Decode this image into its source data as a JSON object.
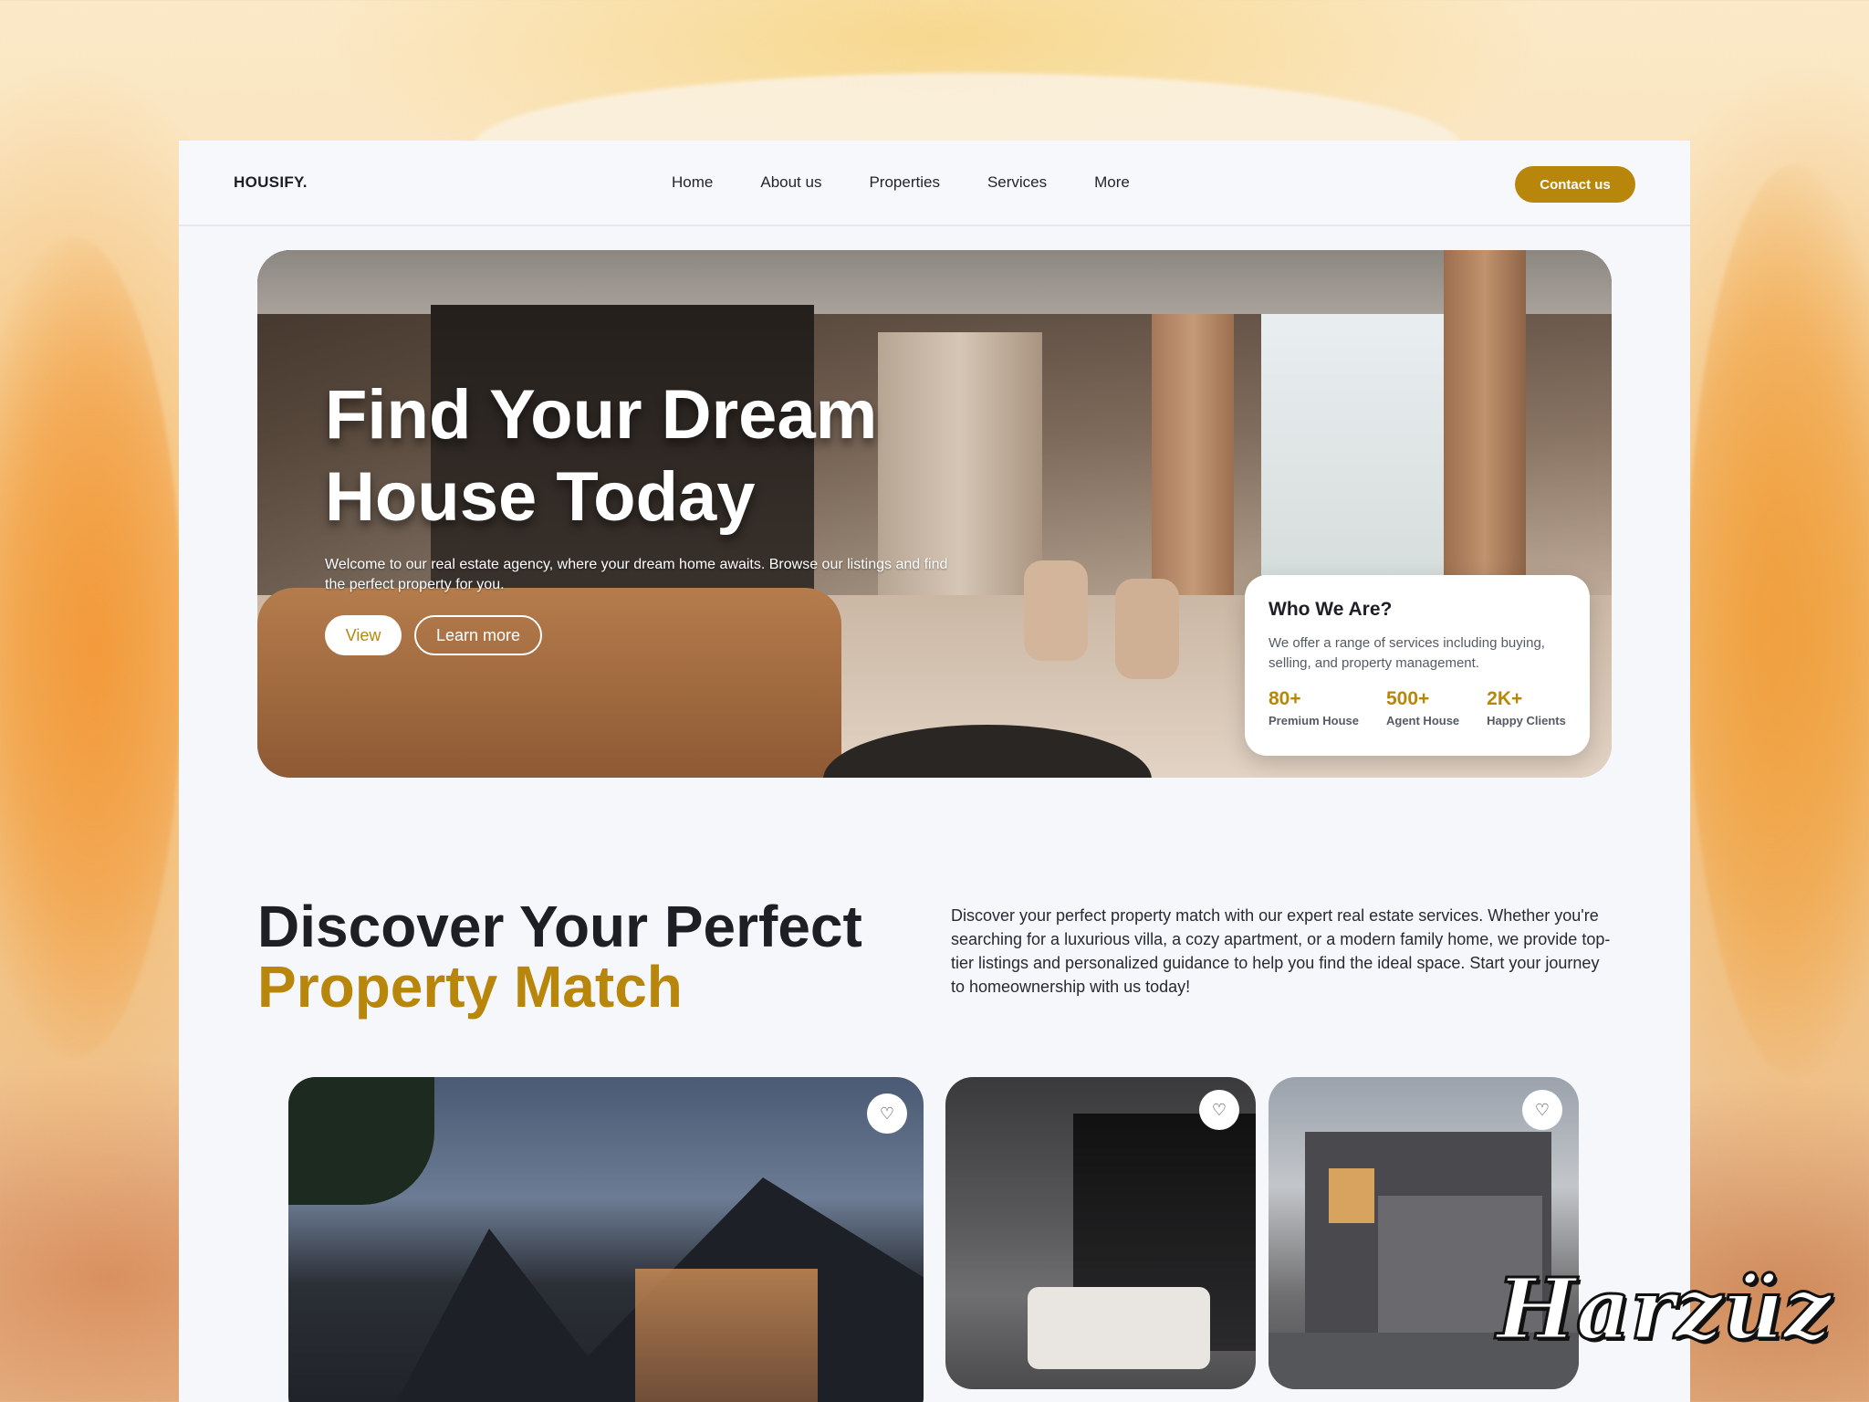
{
  "brand": {
    "logo": "HOUSIFY.",
    "accent": "#b8860b"
  },
  "nav": {
    "items": [
      "Home",
      "About us",
      "Properties",
      "Services",
      "More"
    ],
    "contact_label": "Contact us"
  },
  "hero": {
    "title": "Find Your Dream House Today",
    "subtitle": "Welcome to our real estate agency, where your dream home awaits. Browse our listings and find the perfect property for you.",
    "view_label": "View",
    "learn_label": "Learn more",
    "who": {
      "title": "Who We Are?",
      "text": "We offer a range of services including buying, selling, and property management.",
      "stats": [
        {
          "value": "80+",
          "label": "Premium House"
        },
        {
          "value": "500+",
          "label": "Agent House"
        },
        {
          "value": "2K+",
          "label": "Happy Clients"
        }
      ]
    }
  },
  "discover": {
    "title_line1": "Discover Your Perfect",
    "title_line2": "Property Match",
    "text": "Discover your perfect property match with our expert real estate services. Whether you're searching for a luxurious villa, a cozy apartment, or a modern family home, we provide top-tier listings and personalized guidance to help you find the ideal space. Start your journey to homeownership with us today!"
  },
  "cards": [
    {
      "icon": "heart-icon"
    },
    {
      "icon": "heart-icon"
    },
    {
      "icon": "heart-icon"
    }
  ],
  "watermark": "Harzüz"
}
